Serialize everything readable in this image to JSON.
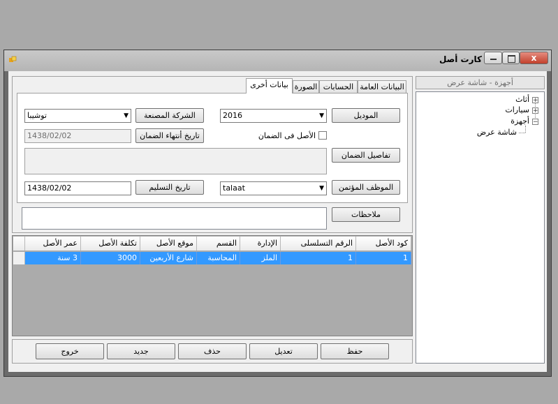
{
  "window": {
    "title": "كارت أصل",
    "min_icon": "minimize-icon",
    "max_icon": "maximize-icon",
    "close_icon": "close-icon",
    "close_glyph": "x"
  },
  "tabs": [
    {
      "label": "البيانات العامة"
    },
    {
      "label": "الحسابات"
    },
    {
      "label": "الصورة"
    },
    {
      "label": "بيانات أخرى"
    }
  ],
  "form": {
    "model_label": "الموديل",
    "model_value": "2016",
    "manufacturer_label": "الشركة المصنعة",
    "manufacturer_value": "توشيبا",
    "warranty_checkbox_label": "الأصل فى الضمان",
    "warranty_end_label": "تاريخ أنتهاء الضمان",
    "warranty_end_value": "1438/02/02",
    "warranty_details_label": "تفاصيل الضمان",
    "warranty_details_value": "",
    "trusted_employee_label": "الموظف المؤتمن",
    "trusted_employee_value": "talaat",
    "delivery_date_label": "تاريخ التسليم",
    "delivery_date_value": "1438/02/02",
    "notes_label": "ملاحظات",
    "notes_value": ""
  },
  "grid": {
    "columns": [
      "كود الأصل",
      "الرقم التسلسلى",
      "الإدارة",
      "القسم",
      "موقع الأصل",
      "تكلفة الأصل",
      "عمر الأصل"
    ],
    "rows": [
      [
        "1",
        "1",
        "الملز",
        "المحاسبة",
        "شارع الأربعين",
        "3000",
        "3 سنة"
      ]
    ]
  },
  "buttons": {
    "save": "حفظ",
    "edit": "تعديل",
    "delete": "حذف",
    "new": "جديد",
    "exit": "خروج"
  },
  "tree": {
    "selected_path": "أجهزة - شاشة عرض",
    "nodes": [
      {
        "label": "أثاث",
        "toggle": "+"
      },
      {
        "label": "سيارات",
        "toggle": "+"
      },
      {
        "label": "أجهزة",
        "toggle": "−"
      },
      {
        "label": "شاشة عرض",
        "toggle": ""
      }
    ]
  },
  "colors": {
    "selection": "#3399ff",
    "grid_background": "#ababab"
  }
}
